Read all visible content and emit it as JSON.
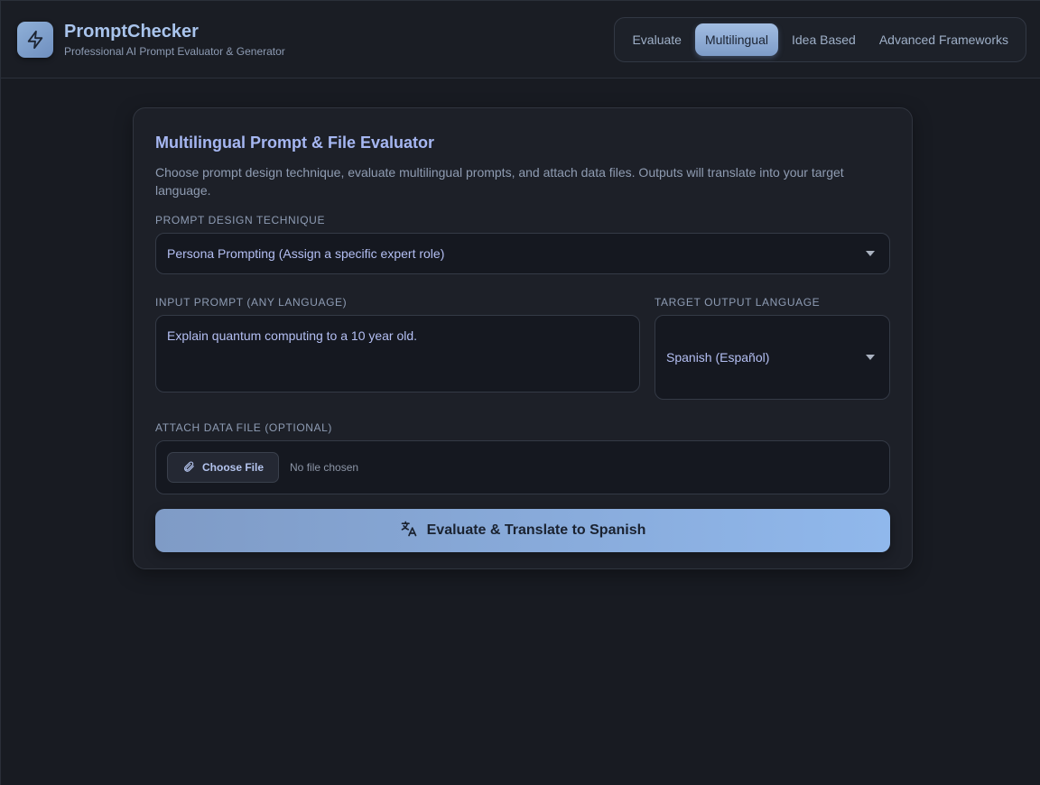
{
  "app": {
    "name": "PromptChecker",
    "tagline": "Professional AI Prompt Evaluator & Generator",
    "logo_icon": "lightning-icon"
  },
  "nav": {
    "tabs": [
      {
        "label": "Evaluate",
        "active": false
      },
      {
        "label": "Multilingual",
        "active": true
      },
      {
        "label": "Idea Based",
        "active": false
      },
      {
        "label": "Advanced Frameworks",
        "active": false
      }
    ]
  },
  "evaluator": {
    "title": "Multilingual Prompt & File Evaluator",
    "description": "Choose prompt design technique, evaluate multilingual prompts, and attach data files. Outputs will translate into your target language.",
    "technique": {
      "label": "Prompt Design Technique",
      "selected": "Persona Prompting (Assign a specific expert role)"
    },
    "input_prompt": {
      "label": "Input Prompt (Any Language)",
      "value": "Explain quantum computing to a 10 year old."
    },
    "target_language": {
      "label": "Target Output Language",
      "selected": "Spanish (Español)"
    },
    "attach_file": {
      "label": "Attach Data File (Optional)",
      "button_label": "Choose File",
      "status": "No file chosen",
      "icon": "paperclip-icon"
    },
    "submit": {
      "label": "Evaluate & Translate to Spanish",
      "icon": "translate-icon"
    }
  },
  "colors": {
    "background": "#181b22",
    "accent": "#90b8ec",
    "title": "#a6b7f2",
    "brand": "#a9c4ec"
  }
}
